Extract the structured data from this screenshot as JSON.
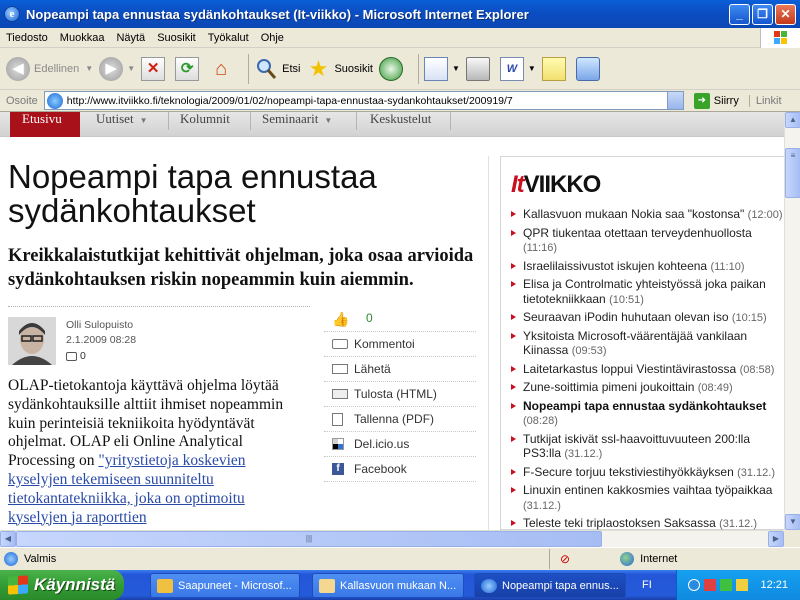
{
  "window": {
    "title": "Nopeampi tapa ennustaa sydänkohtaukset (It-viikko) - Microsoft Internet Explorer"
  },
  "menu": {
    "items": [
      "Tiedosto",
      "Muokkaa",
      "Näytä",
      "Suosikit",
      "Työkalut",
      "Ohje"
    ]
  },
  "toolbar": {
    "back_label": "Edellinen",
    "search_label": "Etsi",
    "favorites_label": "Suosikit"
  },
  "address": {
    "label": "Osoite",
    "url": "http://www.itviikko.fi/teknologia/2009/01/02/nopeampi-tapa-ennustaa-sydankohtaukset/200919/7",
    "go_label": "Siirry",
    "links_label": "Linkit"
  },
  "site": {
    "nav": [
      "Etusivu",
      "Uutiset",
      "Kolumnit",
      "Seminaarit",
      "Keskustelut"
    ],
    "headline": "Nopeampi tapa ennustaa sydänkohtaukset",
    "lead": "Kreikkalaistutkijat kehittivät ohjelman, joka osaa arvioida sydänkohtauksen riskin nopeammin kuin aiemmin.",
    "author": {
      "name": "Olli Sulopuisto",
      "date": "2.1.2009 08:28",
      "comments": "0"
    },
    "body_text": "OLAP-tietokantoja käyttävä ohjelma löytää sydänkohtauksille alttiit ihmiset nopeammin kuin perinteisiä tekniikoita hyödyntävät ohjelmat. OLAP eli Online Analytical Processing on ",
    "body_link": "\"yritystietoja koskevien kyselyjen tekemiseen suunniteltu tietokantatekniikka, joka on optimoitu kyselyjen ja raporttien",
    "tools": {
      "likes": "0",
      "comment": "Kommentoi",
      "send": "Lähetä",
      "print": "Tulosta (HTML)",
      "save": "Tallenna (PDF)",
      "delicious": "Del.icio.us",
      "facebook": "Facebook"
    },
    "logo": {
      "it": "It",
      "viikko": "VIIKKO"
    },
    "news": [
      {
        "title": "Kallasvuon mukaan Nokia saa \"kostonsa\"",
        "time": "(12:00)"
      },
      {
        "title": "QPR tiukentaa otettaan terveydenhuollosta",
        "time": "(11:16)"
      },
      {
        "title": "Israelilaissivustot iskujen kohteena",
        "time": "(11:10)"
      },
      {
        "title": "Elisa ja Controlmatic yhteistyössä joka paikan tietotekniikkaan",
        "time": "(10:51)"
      },
      {
        "title": "Seuraavan iPodin huhutaan olevan iso",
        "time": "(10:15)"
      },
      {
        "title": "Yksitoista Microsoft-väärentäjää vankilaan Kiinassa",
        "time": "(09:53)"
      },
      {
        "title": "Laitetarkastus loppui Viestintävirastossa",
        "time": "(08:58)"
      },
      {
        "title": "Zune-soittimia pimeni joukoittain",
        "time": "(08:49)"
      },
      {
        "title": "Nopeampi tapa ennustaa sydänkohtaukset",
        "time": "(08:28)"
      },
      {
        "title": "Tutkijat iskivät ssl-haavoittuvuuteen 200:lla PS3:lla",
        "time": "(31.12.)"
      },
      {
        "title": "F-Secure torjuu tekstiviestihyökkäyksen",
        "time": "(31.12.)"
      },
      {
        "title": "Linuxin entinen kakkosmies vaihtaa työpaikkaa",
        "time": "(31.12.)"
      },
      {
        "title": "Teleste teki triplaostoksen Saksassa",
        "time": "(31.12.)"
      }
    ]
  },
  "status": {
    "text": "Valmis",
    "zone": "Internet"
  },
  "taskbar": {
    "start_label": "Käynnistä",
    "tasks": [
      "Saapuneet - Microsof...",
      "Kallasvuon mukaan N...",
      "Nopeampi tapa ennus..."
    ],
    "lang": "FI",
    "clock": "12:21"
  },
  "colors": {
    "accent": "#a8101a",
    "link": "#2a4aa8",
    "xp_blue": "#245bd9"
  }
}
